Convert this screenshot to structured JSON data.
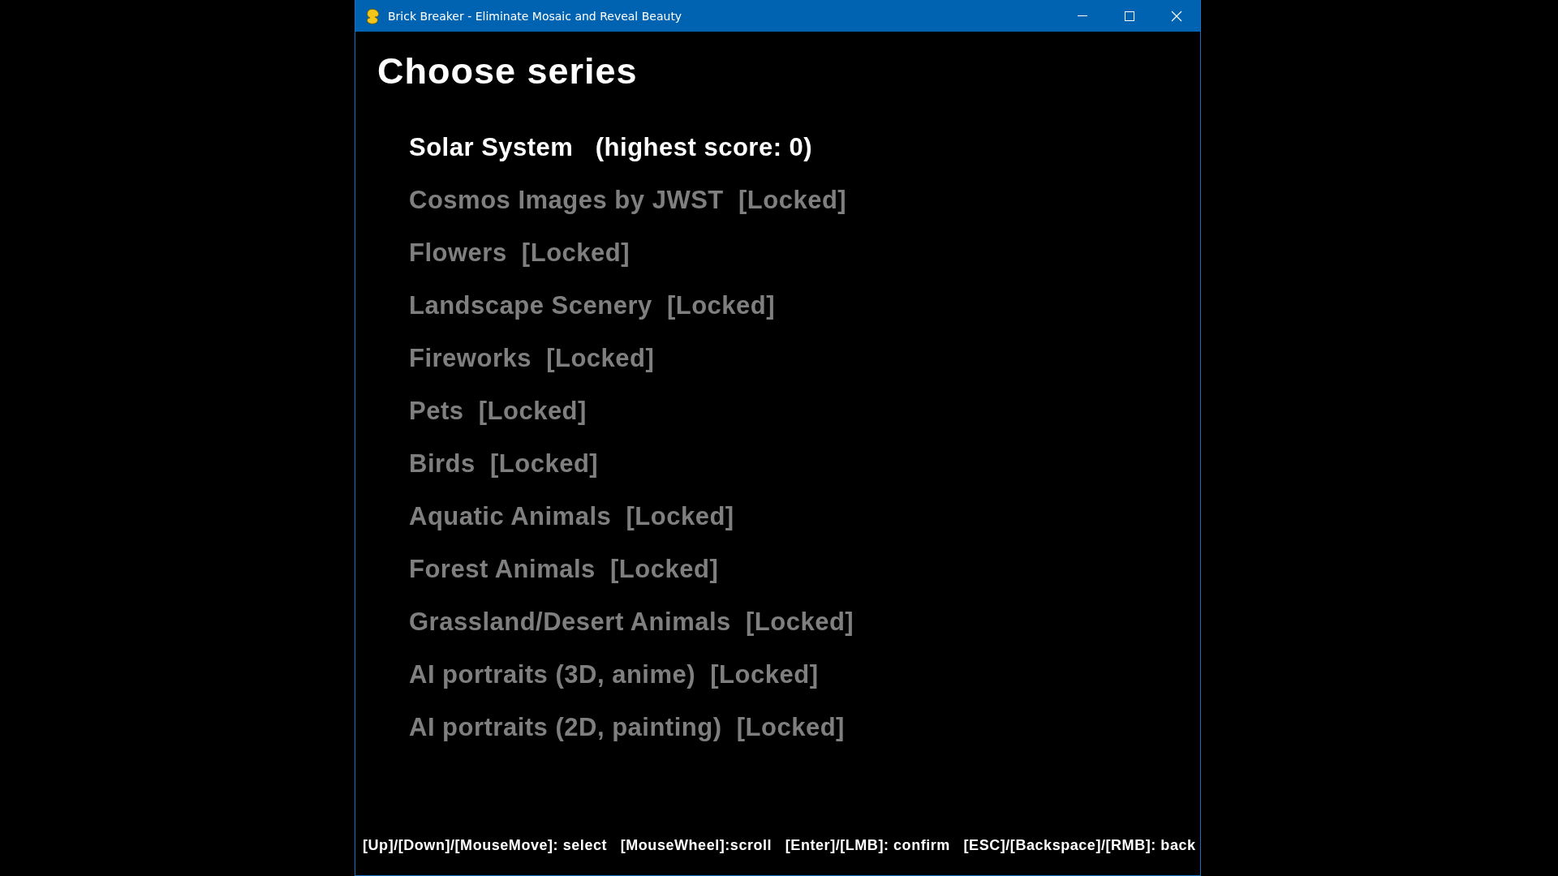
{
  "window": {
    "title": "Brick Breaker - Eliminate Mosaic and Reveal Beauty"
  },
  "heading": "Choose series",
  "series": [
    {
      "label": "Solar System   (highest score: 0)",
      "locked": false
    },
    {
      "label": "Cosmos Images by JWST  [Locked]",
      "locked": true
    },
    {
      "label": "Flowers  [Locked]",
      "locked": true
    },
    {
      "label": "Landscape Scenery  [Locked]",
      "locked": true
    },
    {
      "label": "Fireworks  [Locked]",
      "locked": true
    },
    {
      "label": "Pets  [Locked]",
      "locked": true
    },
    {
      "label": "Birds  [Locked]",
      "locked": true
    },
    {
      "label": "Aquatic Animals  [Locked]",
      "locked": true
    },
    {
      "label": "Forest Animals  [Locked]",
      "locked": true
    },
    {
      "label": "Grassland/Desert Animals  [Locked]",
      "locked": true
    },
    {
      "label": "AI portraits (3D, anime)  [Locked]",
      "locked": true
    },
    {
      "label": "AI portraits (2D, painting)  [Locked]",
      "locked": true
    }
  ],
  "help": "[Up]/[Down]/[MouseMove]: select   [MouseWheel]:scroll   [Enter]/[LMB]: confirm   [ESC]/[Backspace]/[RMB]: back"
}
